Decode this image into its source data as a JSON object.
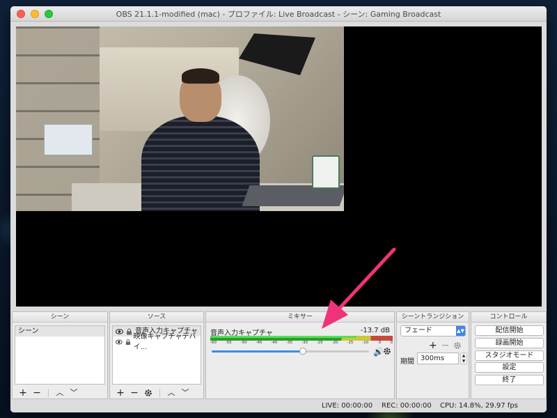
{
  "window": {
    "title": "OBS 21.1.1-modified (mac) - プロファイル: Live Broadcast - シーン: Gaming Broadcast"
  },
  "docks": {
    "scenes": {
      "header": "シーン",
      "items": [
        "シーン"
      ],
      "toolbar": [
        "+",
        "−",
        "^",
        "v"
      ]
    },
    "sources": {
      "header": "ソース",
      "items": [
        {
          "label": "音声入力キャプチャ",
          "visible_icon": "eye-icon",
          "lock_icon": "lock-icon"
        },
        {
          "label": "映像キャプチャデバイ...",
          "visible_icon": "eye-icon",
          "lock_icon": "lock-icon"
        }
      ],
      "toolbar": [
        "+",
        "−",
        "gear",
        "^",
        "v"
      ]
    },
    "mixer": {
      "header": "ミキサー",
      "channel": {
        "name": "音声入力キャプチャ",
        "level_db": "-13.7 dB",
        "meter_level": 0.8,
        "volume_fraction": 0.58,
        "scale": [
          "-60",
          "-55",
          "-50",
          "-45",
          "-40",
          "-35",
          "-30",
          "-25",
          "-20",
          "-15",
          "-10",
          "-5",
          "0"
        ]
      }
    },
    "transitions": {
      "header": "シーントランジション",
      "selected": "フェード",
      "duration_label": "期間",
      "duration_value": "300ms"
    },
    "controls": {
      "header": "コントロール",
      "buttons": [
        "配信開始",
        "録画開始",
        "スタジオモード",
        "設定",
        "終了"
      ]
    }
  },
  "status": {
    "live": "LIVE: 00:00:00",
    "rec": "REC: 00:00:00",
    "cpu": "CPU: 14.8%, 29.97 fps"
  },
  "colors": {
    "annotation_arrow": "#f0327a",
    "select_accent": "#3f86e8",
    "slider_accent": "#3a8ee6"
  }
}
